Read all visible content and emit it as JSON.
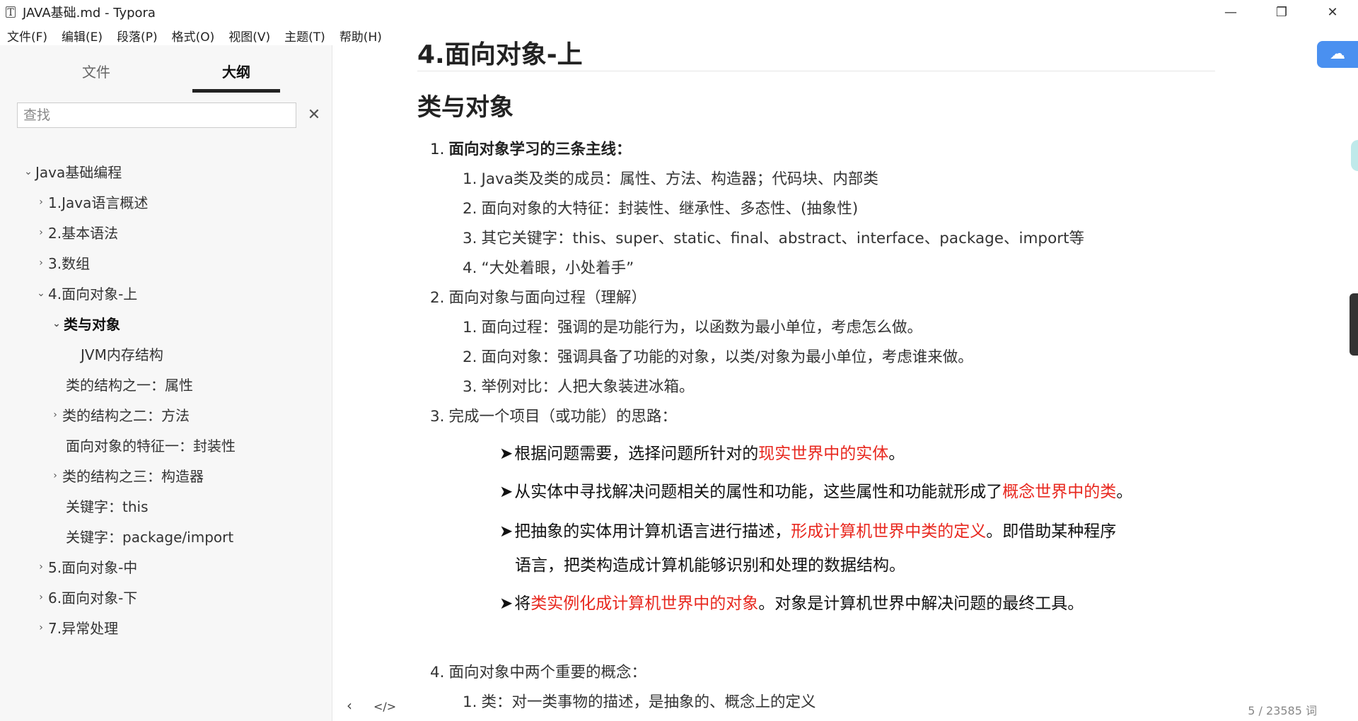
{
  "window": {
    "title": "JAVA基础.md - Typora",
    "app_icon": "T",
    "minimize": "—",
    "maximize": "❐",
    "close": "✕"
  },
  "menubar": {
    "items": [
      "文件(F)",
      "编辑(E)",
      "段落(P)",
      "格式(O)",
      "视图(V)",
      "主题(T)",
      "帮助(H)"
    ]
  },
  "sidebar": {
    "tabs": [
      "文件",
      "大纲"
    ],
    "active_tab": "大纲",
    "search_placeholder": "查找",
    "clear": "✕",
    "outline": [
      {
        "label": "Java基础编程",
        "chevron": "⌄",
        "expanded": true
      },
      {
        "label": "1.Java语言概述",
        "chevron": "›"
      },
      {
        "label": "2.基本语法",
        "chevron": "›"
      },
      {
        "label": "3.数组",
        "chevron": "›"
      },
      {
        "label": "4.面向对象-上",
        "chevron": "⌄",
        "expanded": true
      },
      {
        "label": "类与对象",
        "chevron": "⌄",
        "active": true
      },
      {
        "label": "JVM内存结构",
        "chevron": ""
      },
      {
        "label": "类的结构之一：属性",
        "chevron": ""
      },
      {
        "label": "类的结构之二：方法",
        "chevron": "›"
      },
      {
        "label": "面向对象的特征一：封装性",
        "chevron": ""
      },
      {
        "label": "类的结构之三：构造器",
        "chevron": "›"
      },
      {
        "label": "关键字：this",
        "chevron": ""
      },
      {
        "label": "关键字：package/import",
        "chevron": ""
      },
      {
        "label": "5.面向对象-中",
        "chevron": "›"
      },
      {
        "label": "6.面向对象-下",
        "chevron": "›"
      },
      {
        "label": "7.异常处理",
        "chevron": "›"
      }
    ]
  },
  "editor": {
    "h1": "4.面向对象-上",
    "h2": "类与对象",
    "list": {
      "item1": {
        "num": "1.",
        "text": "面向对象学习的三条主线："
      },
      "item1_sub": [
        {
          "num": "1.",
          "text": "Java类及类的成员：属性、方法、构造器；代码块、内部类"
        },
        {
          "num": "2.",
          "text": "面向对象的大特征：封装性、继承性、多态性、(抽象性)"
        },
        {
          "num": "3.",
          "text": "其它关键字：this、super、static、final、abstract、interface、package、import等"
        },
        {
          "num": "4.",
          "text": "“大处着眼，小处着手”"
        }
      ],
      "item2": {
        "num": "2.",
        "text": "面向对象与面向过程（理解）"
      },
      "item2_sub": [
        {
          "num": "1.",
          "text": "面向过程：强调的是功能行为，以函数为最小单位，考虑怎么做。"
        },
        {
          "num": "2.",
          "text": "面向对象：强调具备了功能的对象，以类/对象为最小单位，考虑谁来做。"
        },
        {
          "num": "3.",
          "text": "举例对比：人把大象装进冰箱。"
        }
      ],
      "item3": {
        "num": "3.",
        "text": "完成一个项目（或功能）的思路："
      },
      "item4": {
        "num": "4.",
        "text": "面向对象中两个重要的概念："
      },
      "item4_sub": [
        {
          "num": "1.",
          "text": "类：对一类事物的描述，是抽象的、概念上的定义"
        }
      ]
    },
    "image_text": {
      "arrow": "➤",
      "l1a": "根据问题需要，选择问题所针对的",
      "l1b": "现实世界中的实体",
      "l1c": "。",
      "l2a": "从实体中寻找解决问题相关的属性和功能，这些属性和功能就形成了",
      "l2b": "概念世界中的类",
      "l2c": "。",
      "l3a": "把抽象的实体用计算机语言进行描述，",
      "l3b": "形成计算机世界中类的定义",
      "l3c": "。即借助某种程序",
      "l3d": "语言，把类构造成计算机能够识别和处理的数据结构。",
      "l4a": "将",
      "l4b": "类实例化成计算机世界中的对象",
      "l4c": "。对象是计算机世界中解决问题的最终工具。"
    }
  },
  "statusbar": {
    "back": "‹",
    "source": "</>",
    "wordcount": "5 / 23585 词"
  },
  "colors": {
    "highlight_red": "#e8271e",
    "cloud_blue": "#4a90f0"
  },
  "icons": {
    "cloud": "cloud-sync-icon"
  }
}
